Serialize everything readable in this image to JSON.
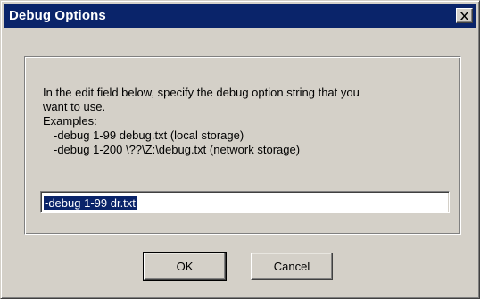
{
  "window": {
    "title": "Debug Options",
    "close_glyph": "close-icon"
  },
  "instructions": {
    "line1": "In the edit field below, specify the debug option string that you",
    "line2": "want to use.",
    "examples_label": "Examples:",
    "example1": "-debug 1-99 debug.txt (local storage)",
    "example2": "-debug 1-200 \\??\\Z:\\debug.txt (network storage)"
  },
  "debug_option_field": {
    "value": "-debug 1-99 dr.txt"
  },
  "buttons": {
    "ok": "OK",
    "cancel": "Cancel"
  },
  "colors": {
    "titlebar": "#0a246a",
    "face": "#d4d0c8",
    "selection": "#0a246a"
  }
}
